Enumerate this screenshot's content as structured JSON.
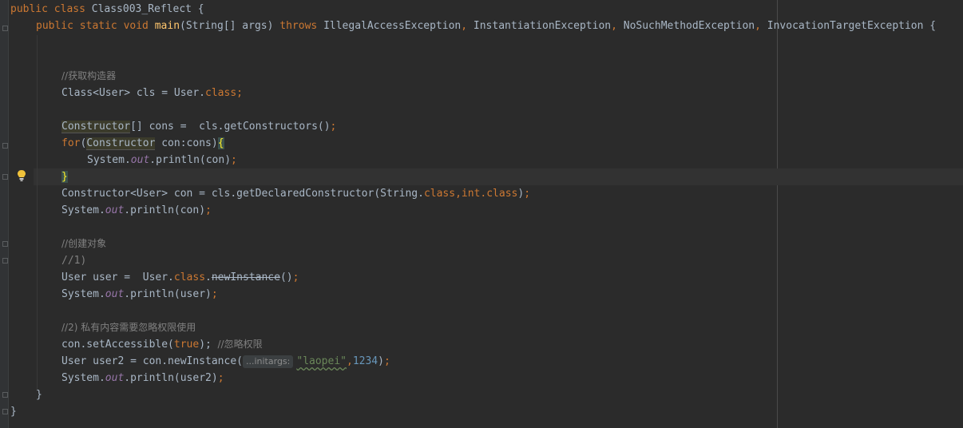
{
  "code": {
    "l1_kw": "public class ",
    "l1_name": "Class003_Reflect {",
    "l2_kw": "public static void ",
    "l2_fn": "main",
    "l2_args": "(String[] args) ",
    "l2_throws": "throws ",
    "l2_ex1": "IllegalAccessException",
    "l2_ex2": "InstantiationException",
    "l2_ex3": "NoSuchMethodException",
    "l2_ex4": "InvocationTargetException {",
    "comma": ", ",
    "l3_comment": "//获取构造器",
    "l4_a": "Class<User> cls = User.",
    "l4_kw": "class;",
    "l5_type": "Constructor",
    "l5_rest": "[] cons =  cls.getConstructors()",
    "semi": ";",
    "l6_for": "for",
    "l6_paren": "(",
    "l6_type": "Constructor",
    "l6_rest": " con:cons)",
    "l6_brace": "{",
    "sys": "System.",
    "out": "out",
    "l7_rest": ".println(con)",
    "l8_brace": "}",
    "l9_a": "Constructor<User> con = cls.getDeclaredConstructor(String.",
    "l9_kw1": "class,int.class",
    "l9_end": ")",
    "l10_rest": ".println(con)",
    "l11_comment": "//创建对象",
    "l12_comment": "//1)",
    "l13_a": "User user =  User.",
    "l13_kw": "class",
    "l13_dot": ".",
    "l13_method": "newInstance",
    "l13_end": "()",
    "l14_rest": ".println(user)",
    "l15_comment": "//2) 私有内容需要忽略权限使用",
    "l16_a": "con.setAccessible(",
    "l16_true": "true",
    "l16_end": ");",
    "l16_comment": "  //忽略权限",
    "l17_a": "User user2 = con.newInstance(",
    "l17_hint": "...initargs:",
    "l17_str": "\"laopei\"",
    "l17_comma": ",",
    "l17_num": "1234",
    "l17_end": ")",
    "l18_rest": ".println(user2)",
    "close1": "}",
    "close2": "}"
  }
}
